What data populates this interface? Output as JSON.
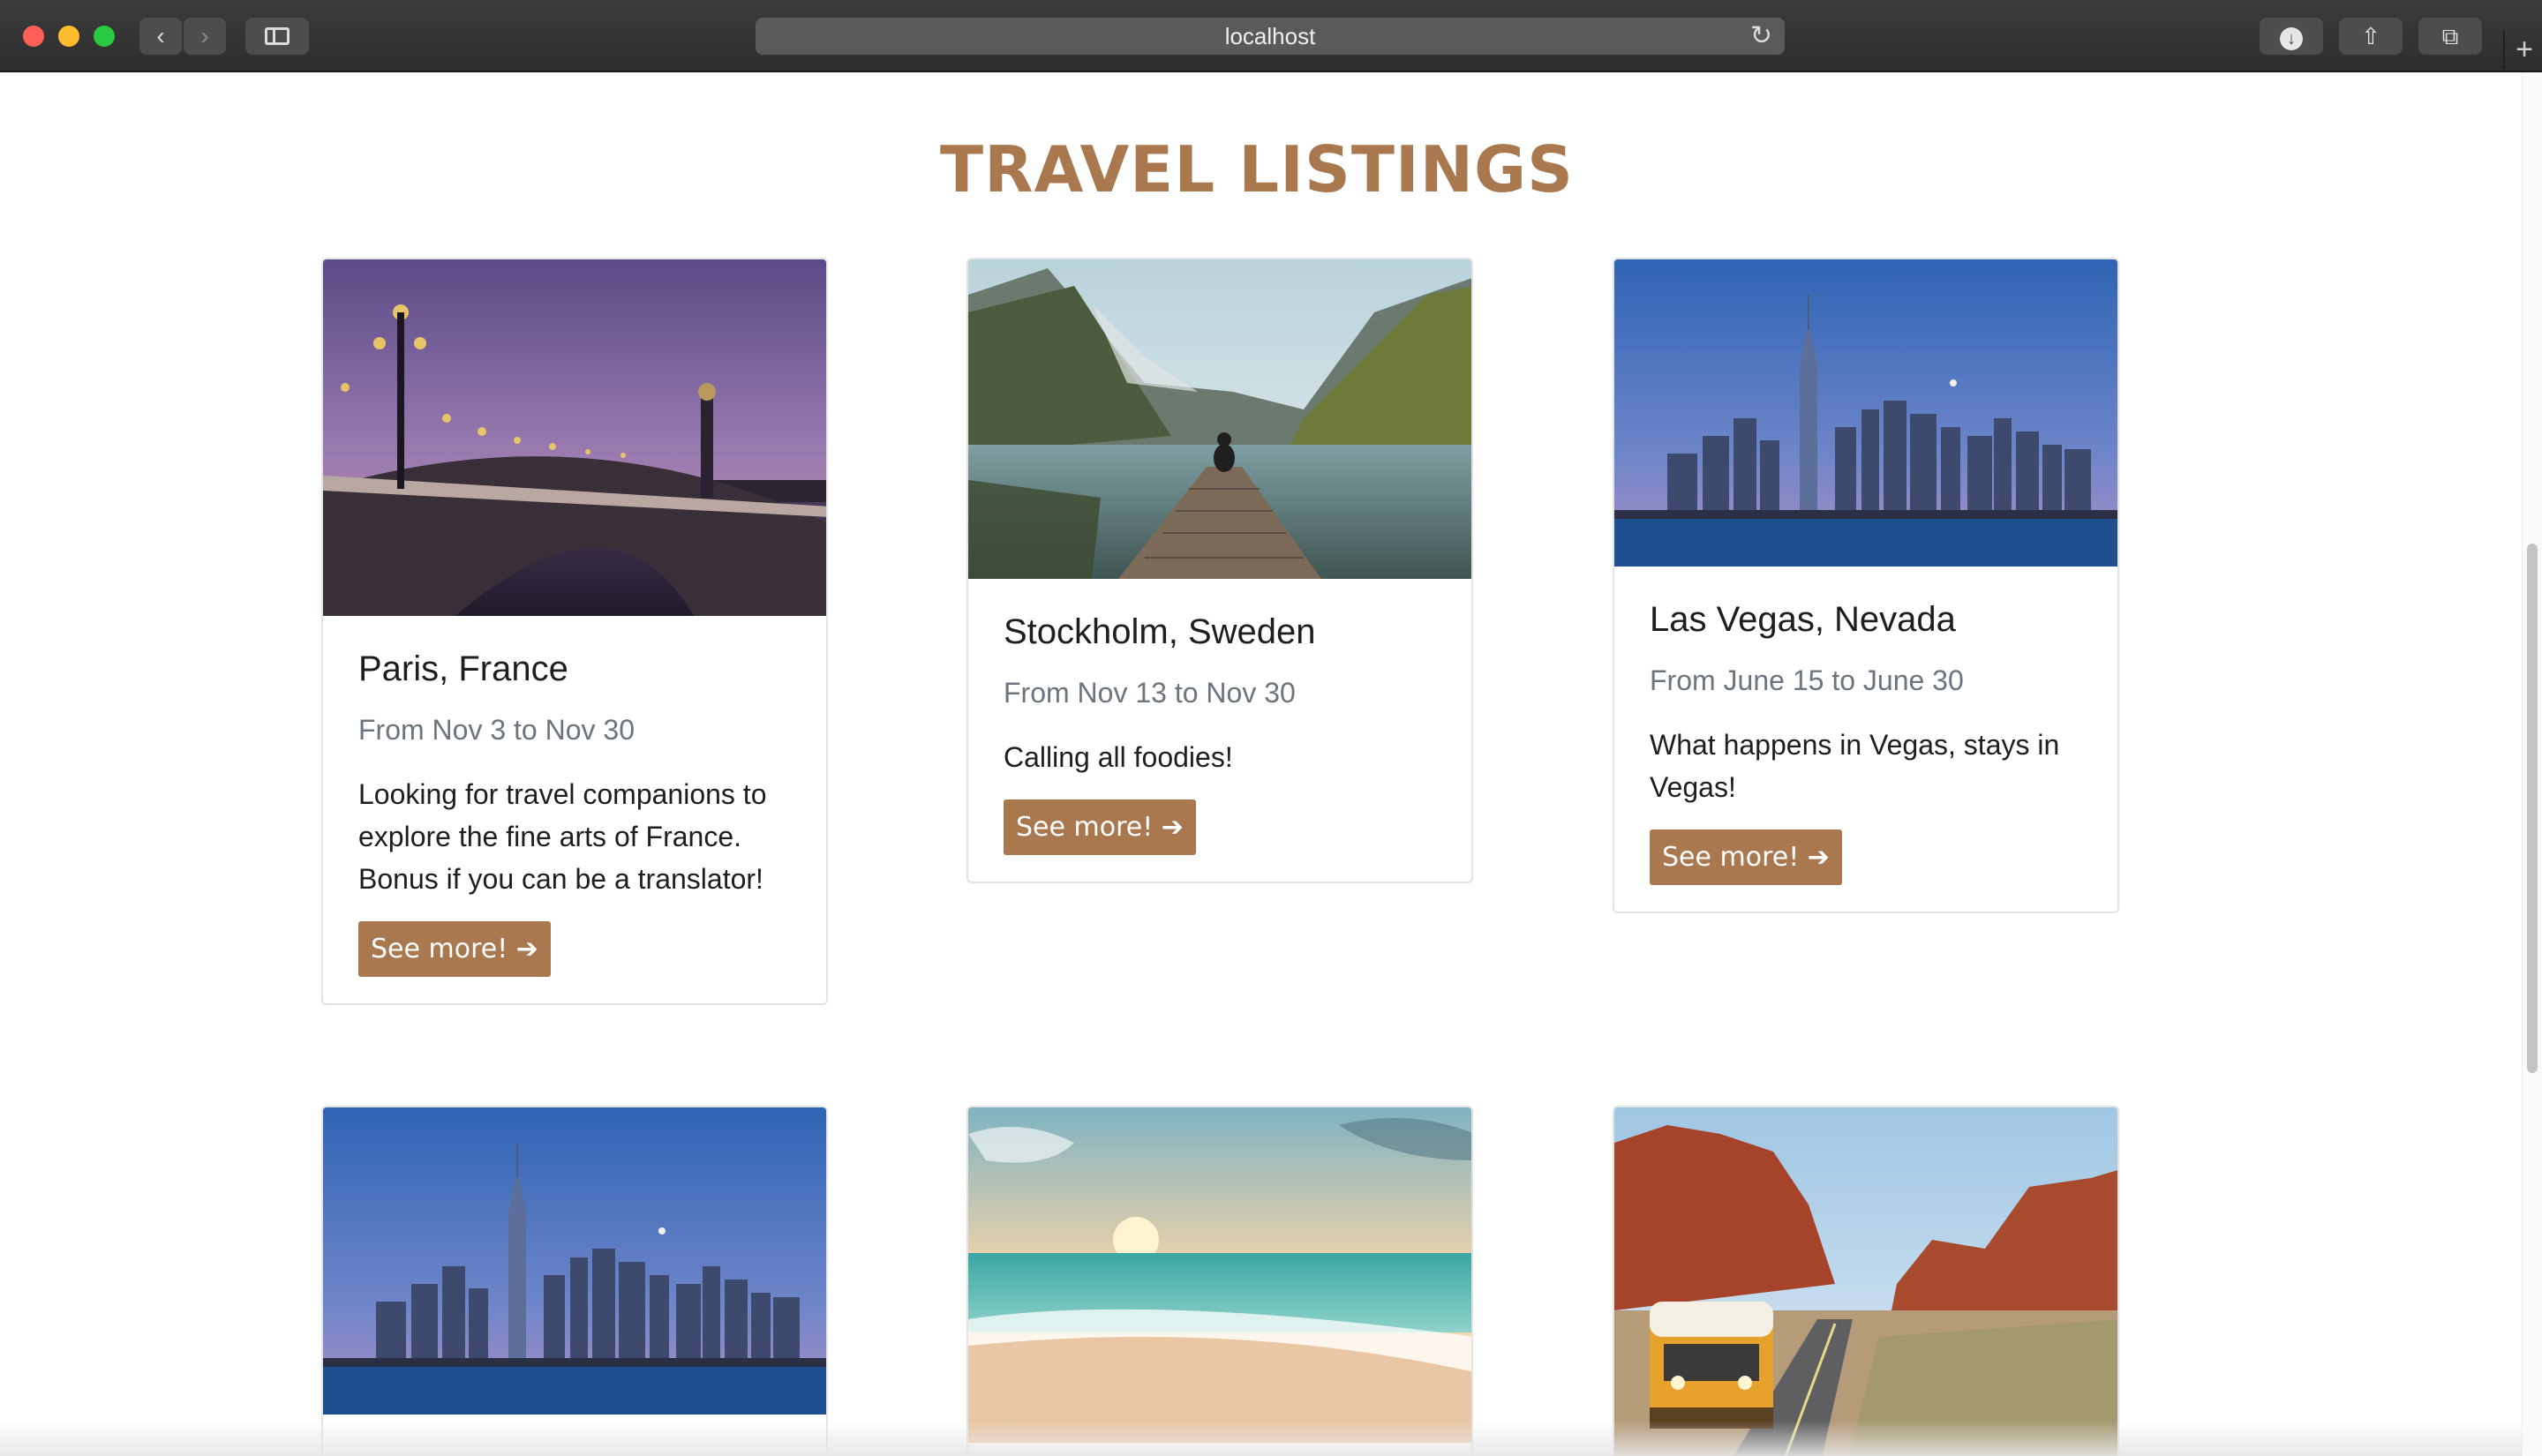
{
  "browser": {
    "url": "localhost",
    "reload_icon": "reload-icon",
    "back_icon": "chevron-left-icon",
    "forward_icon": "chevron-right-icon",
    "download_icon": "download-icon",
    "share_icon": "share-icon",
    "tabs_icon": "tabs-icon",
    "new_tab_icon": "plus-icon",
    "glyphs": {
      "back": "‹",
      "forward": "›",
      "reload": "↻",
      "share": "⇧",
      "tabs": "⧉",
      "new_tab": "+",
      "download": "↓"
    }
  },
  "page": {
    "title": "TRAVEL LISTINGS"
  },
  "listings": [
    {
      "title": "Paris, France",
      "dates": "From Nov 3 to Nov 30",
      "description": "Looking for travel companions to explore the fine arts of France. Bonus if you can be a translator!",
      "button": "See more! ➔",
      "image": "paris-bridge-dusk"
    },
    {
      "title": "Stockholm, Sweden",
      "dates": "From Nov 13 to Nov 30",
      "description": "Calling all foodies!",
      "button": "See more! ➔",
      "image": "lake-dock-mountains"
    },
    {
      "title": "Las Vegas, Nevada",
      "dates": "From June 15 to June 30",
      "description": "What happens in Vegas, stays in Vegas!",
      "button": "See more! ➔",
      "image": "city-skyline-dusk"
    },
    {
      "image": "city-skyline-dusk"
    },
    {
      "image": "beach-sunset"
    },
    {
      "image": "desert-road-van"
    }
  ],
  "colors": {
    "accent": "#a9784f",
    "muted_text": "#6c757d",
    "chrome": "#2e2e2e"
  }
}
